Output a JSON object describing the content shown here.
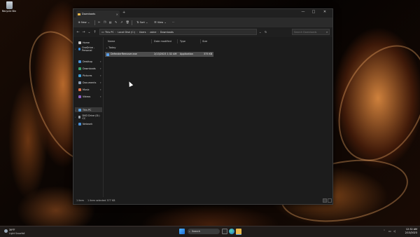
{
  "desktop": {
    "recycle_bin_label": "Recycle Bin"
  },
  "window": {
    "tab_title": "Downloads",
    "new_tab_symbol": "+",
    "close_tab_symbol": "×",
    "controls": {
      "minimize": "—",
      "maximize": "□",
      "close": "✕"
    }
  },
  "toolbar": {
    "new_label": "New",
    "sort_label": "Sort",
    "view_label": "View",
    "more_label": "···"
  },
  "address": {
    "crumbs": [
      "This PC",
      "Local Disk (C:)",
      "Users",
      "zaine",
      "Downloads"
    ],
    "search_placeholder": "Search Downloads"
  },
  "navpane": {
    "items": [
      {
        "label": "Home",
        "pinned": false
      },
      {
        "label": "OneDrive - Personal",
        "pinned": false
      },
      {
        "label": "Desktop",
        "pinned": true
      },
      {
        "label": "Downloads",
        "pinned": true
      },
      {
        "label": "Pictures",
        "pinned": true
      },
      {
        "label": "Documents",
        "pinned": true
      },
      {
        "label": "Music",
        "pinned": true
      },
      {
        "label": "Videos",
        "pinned": true
      },
      {
        "label": "This PC",
        "pinned": false
      },
      {
        "label": "DVD Drive (D:) CC",
        "pinned": false
      },
      {
        "label": "Network",
        "pinned": false
      }
    ]
  },
  "files": {
    "columns": [
      "Name",
      "Date modified",
      "Type",
      "Size"
    ],
    "group_label": "Today",
    "rows": [
      {
        "name": "DefenderRemover.exe",
        "date": "2/13/2023 1:32 AM",
        "type": "Application",
        "size": "375 KB"
      }
    ]
  },
  "status": {
    "item_count": "1 item",
    "selected": "1 item selected  377 KB"
  },
  "taskbar": {
    "weather_temp": "39°F",
    "weather_desc": "Light Snowfall",
    "search_label": "Search",
    "time": "12:32 AM",
    "date": "2/13/2023"
  },
  "colors": {
    "folder": "#e8b74a",
    "selected_row": "#4d4d4d",
    "accent": "#5a9ee8"
  }
}
